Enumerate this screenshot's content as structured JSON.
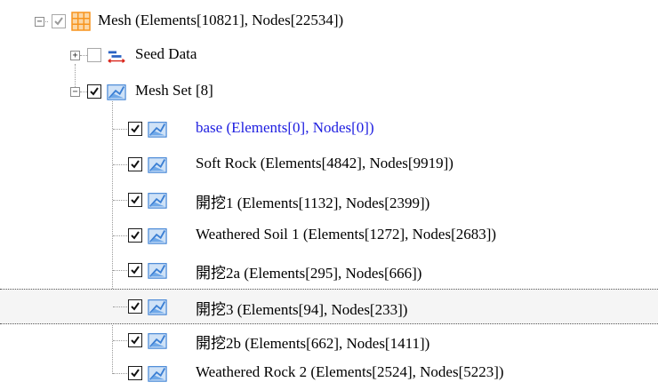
{
  "tree": {
    "root": {
      "label": "Mesh (Elements[10821], Nodes[22534])",
      "toggle": "−",
      "checked": true,
      "disabled": true
    },
    "seed": {
      "label": "Seed Data",
      "toggle": "+",
      "checked": false
    },
    "meshset": {
      "label": "Mesh Set [8]",
      "toggle": "−",
      "checked": true
    },
    "items": [
      {
        "label": "base (Elements[0], Nodes[0])",
        "checked": true,
        "highlight": true
      },
      {
        "label": "Soft Rock (Elements[4842], Nodes[9919])",
        "checked": true
      },
      {
        "label": "開挖1 (Elements[1132], Nodes[2399])",
        "checked": true
      },
      {
        "label": "Weathered Soil 1 (Elements[1272], Nodes[2683])",
        "checked": true
      },
      {
        "label": "開挖2a (Elements[295], Nodes[666])",
        "checked": true
      },
      {
        "label": "開挖3 (Elements[94], Nodes[233])",
        "checked": true,
        "selected": true
      },
      {
        "label": "開挖2b (Elements[662], Nodes[1411])",
        "checked": true
      },
      {
        "label": "Weathered Rock 2 (Elements[2524], Nodes[5223])",
        "checked": true
      }
    ]
  },
  "colors": {
    "highlight_text": "#1d1de0",
    "grid_icon": "#f7941d",
    "meshset_icon": "#3b7fd4"
  }
}
